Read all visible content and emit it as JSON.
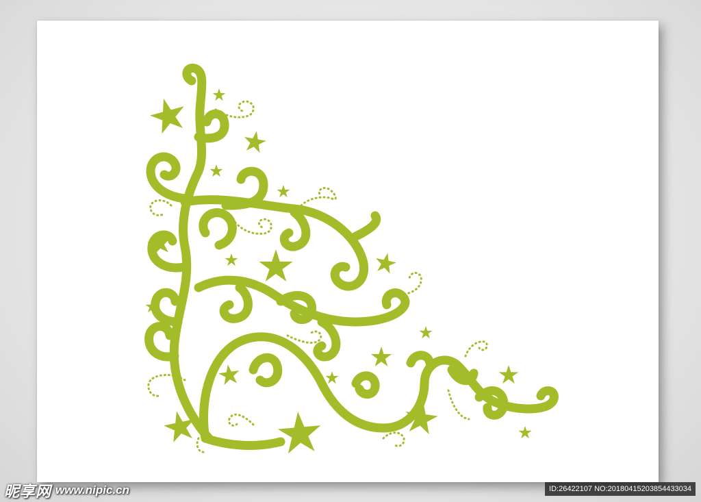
{
  "watermark": {
    "logo_text": "昵享网",
    "site_url": "www.nipic.cn",
    "image_id": "ID:26422107 NO:20180415203854433034"
  },
  "colors": {
    "ornament": "#a3bd2a",
    "card": "#ffffff",
    "background": "#e2e2e2"
  },
  "icons": {
    "ornament": "swirl-vine-corner-icon",
    "stars": "star-icon"
  }
}
